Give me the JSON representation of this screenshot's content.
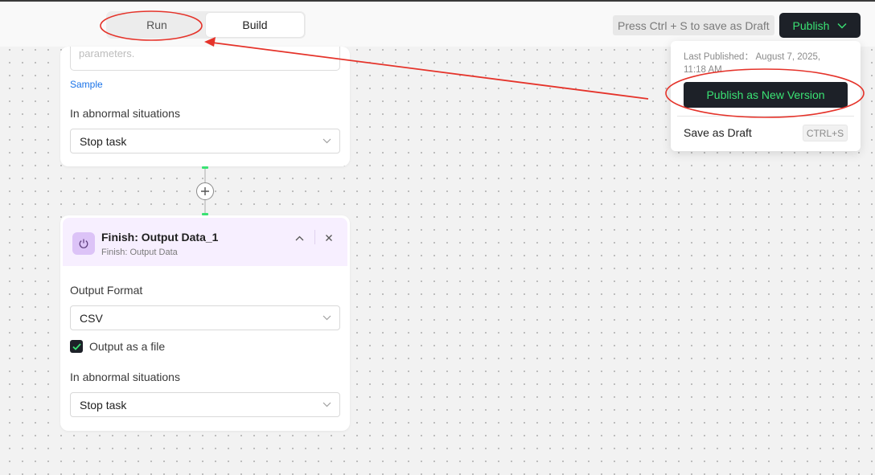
{
  "topbar": {
    "tabs": [
      {
        "label": "Run",
        "active": false
      },
      {
        "label": "Build",
        "active": true
      }
    ],
    "save_hint": "Press Ctrl + S to save as Draft",
    "publish_label": "Publish"
  },
  "nodes": [
    {
      "params_placeholder": "parameters.",
      "sample_link": "Sample",
      "abnormal_label": "In abnormal situations",
      "abnormal_value": "Stop task"
    },
    {
      "title": "Finish: Output Data_1",
      "subtitle": "Finish: Output Data",
      "output_format_label": "Output Format",
      "output_format_value": "CSV",
      "output_file_label": "Output as a file",
      "output_file_checked": true,
      "abnormal_label": "In abnormal situations",
      "abnormal_value": "Stop task"
    }
  ],
  "publish_menu": {
    "last_published": "Last Published： August 7, 2025, 11:18 AM",
    "publish_new_label": "Publish as New Version",
    "save_draft_label": "Save as Draft",
    "save_draft_shortcut": "CTRL+S"
  },
  "colors": {
    "accent_green": "#3ae374",
    "dark": "#1d2128",
    "node_header": "#f7efff",
    "annotation_red": "#e5332a"
  }
}
